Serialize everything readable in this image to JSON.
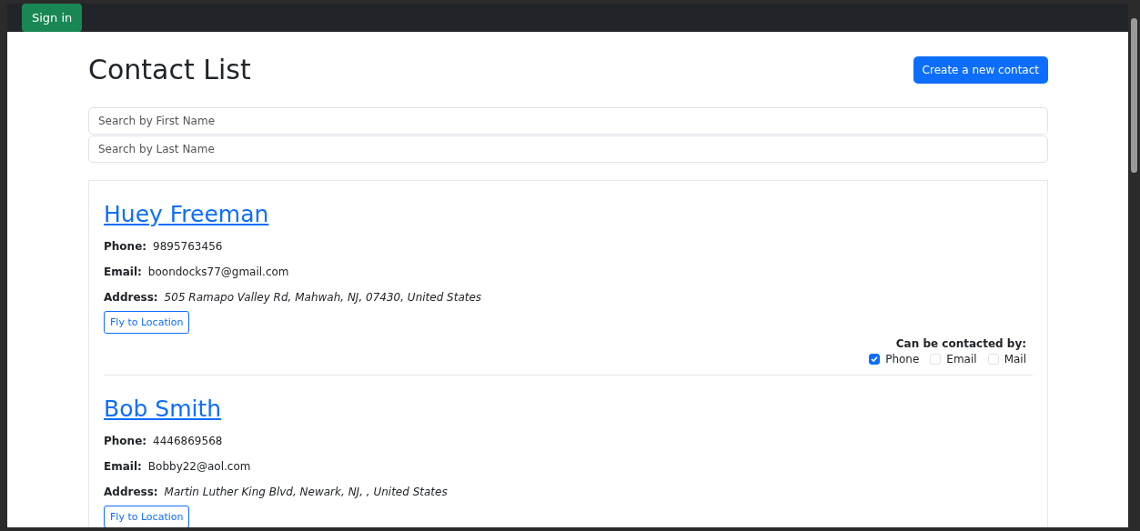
{
  "navbar": {
    "sign_in": "Sign in"
  },
  "header": {
    "title": "Contact List",
    "create_button": "Create a new contact"
  },
  "search": [
    {
      "placeholder": "Search by First Name"
    },
    {
      "placeholder": "Search by Last Name"
    }
  ],
  "contacts": [
    {
      "name": "Huey Freeman",
      "fields": [
        {
          "label": "Phone:",
          "value": "9895763456",
          "italic": false
        },
        {
          "label": "Email:",
          "value": "boondocks77@gmail.com",
          "italic": false
        },
        {
          "label": "Address:",
          "value": "505 Ramapo Valley Rd, Mahwah, NJ, 07430, United States",
          "italic": true
        }
      ],
      "button": "Fly to Location",
      "contact_heading": "Can be contacted by:",
      "methods": [
        {
          "label": "Phone",
          "checked": true
        },
        {
          "label": "Email",
          "checked": false
        },
        {
          "label": "Mail",
          "checked": false
        }
      ]
    },
    {
      "name": "Bob Smith",
      "fields": [
        {
          "label": "Phone:",
          "value": "4446869568",
          "italic": false
        },
        {
          "label": "Email:",
          "value": "Bobby22@aol.com",
          "italic": false
        },
        {
          "label": "Address:",
          "value": "Martin Luther King Blvd, Newark, NJ, , United States",
          "italic": true
        }
      ],
      "button": "Fly to Location"
    }
  ]
}
